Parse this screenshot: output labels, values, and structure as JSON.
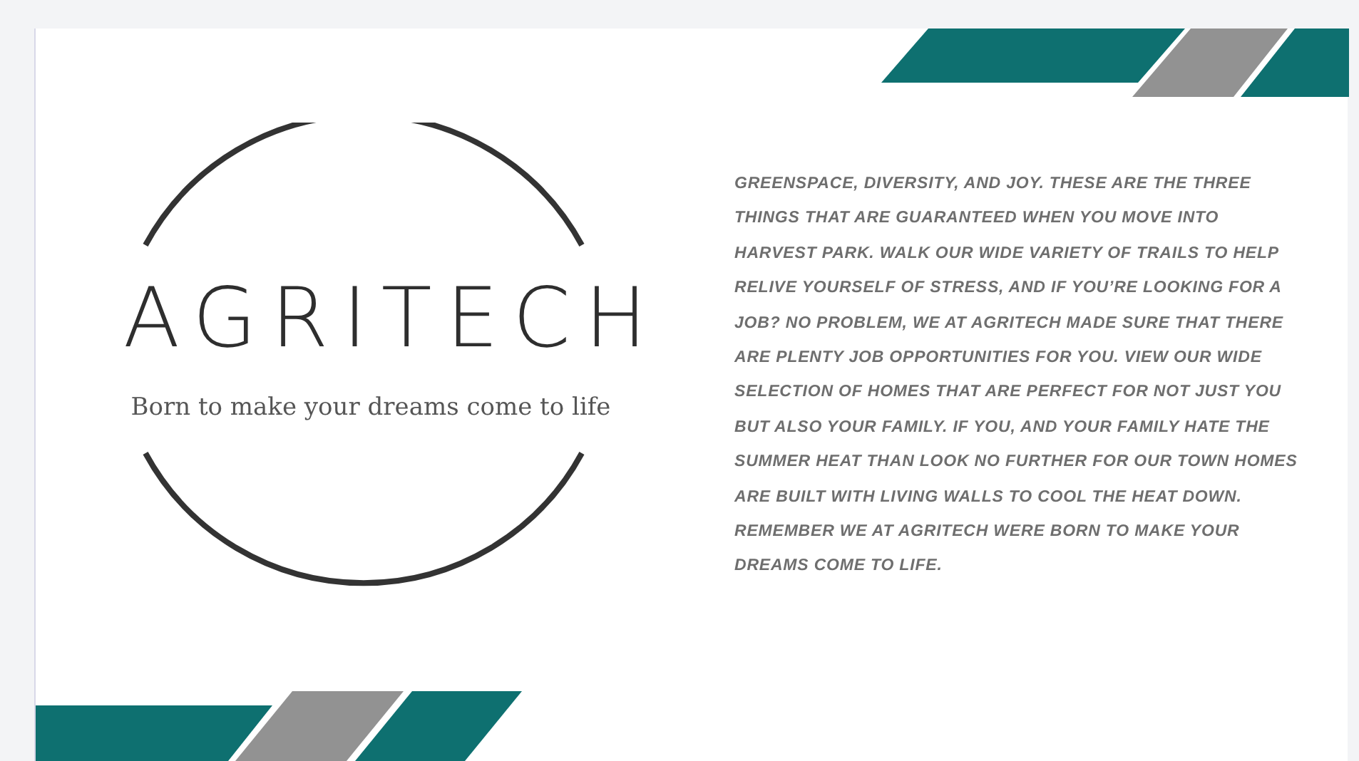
{
  "slide": {
    "logo": {
      "wordmark": "AGRITECH",
      "tagline": "Born to make your dreams come to life"
    },
    "body": "GREENSPACE, DIVERSITY, AND JOY. THESE ARE THE THREE THINGS THAT ARE GUARANTEED WHEN YOU MOVE INTO HARVEST PARK. WALK OUR WIDE VARIETY OF TRAILS TO HELP RELIVE YOURSELF OF STRESS, AND IF YOU’RE LOOKING FOR A JOB? NO PROBLEM, WE AT AGRITECH MADE SURE THAT THERE ARE PLENTY JOB OPPORTUNITIES FOR YOU. VIEW OUR WIDE SELECTION OF HOMES THAT ARE PERFECT FOR NOT JUST YOU BUT ALSO YOUR FAMILY. IF YOU, AND YOUR FAMILY HATE THE SUMMER HEAT THAN LOOK NO FURTHER FOR OUR TOWN HOMES ARE BUILT WITH LIVING WALLS TO COOL THE HEAT DOWN. REMEMBER WE AT AGRITECH WERE BORN TO MAKE YOUR DREAMS COME TO LIFE."
  }
}
